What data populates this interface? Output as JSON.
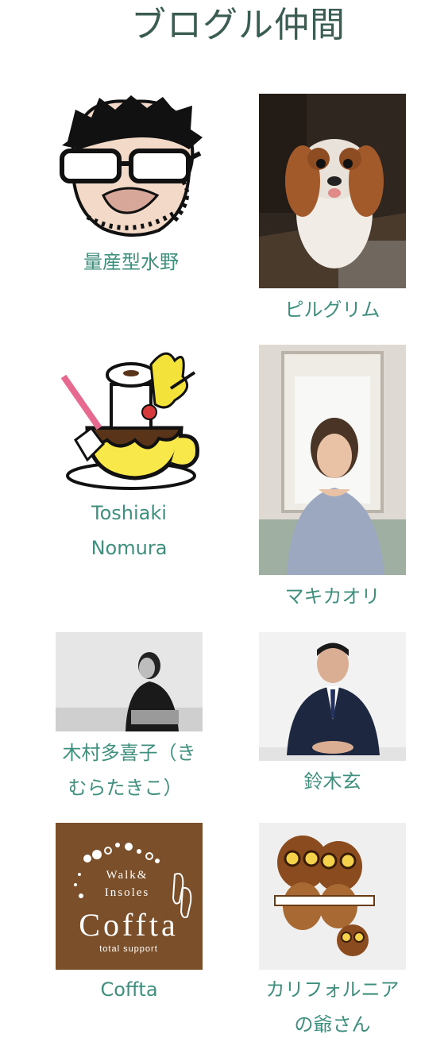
{
  "section": {
    "title": "ブログル仲間"
  },
  "members": [
    {
      "name": "量産型水野",
      "avatar": "cartoon-man-glasses-avatar"
    },
    {
      "name": "ピルグリム",
      "avatar": "cavalier-dog-photo"
    },
    {
      "name_lines": [
        "Toshiaki",
        "Nomura"
      ],
      "avatar": "coffee-cup-illustration"
    },
    {
      "name": "マキカオリ",
      "avatar": "woman-portrait-photo"
    },
    {
      "name_lines": [
        "木村多喜子（き",
        "むらたきこ）"
      ],
      "avatar": "woman-bw-photo"
    },
    {
      "name": "鈴木玄",
      "avatar": "man-in-suit-photo"
    },
    {
      "name": "Coffta",
      "avatar": "coffta-logo",
      "logo_text": {
        "line1": "Walk&",
        "line2": "Insoles",
        "brand": "Coffta",
        "tagline": "total support"
      }
    },
    {
      "name_lines": [
        "カリフォルニア",
        "の爺さん"
      ],
      "avatar": "wooden-owls-photo"
    }
  ]
}
